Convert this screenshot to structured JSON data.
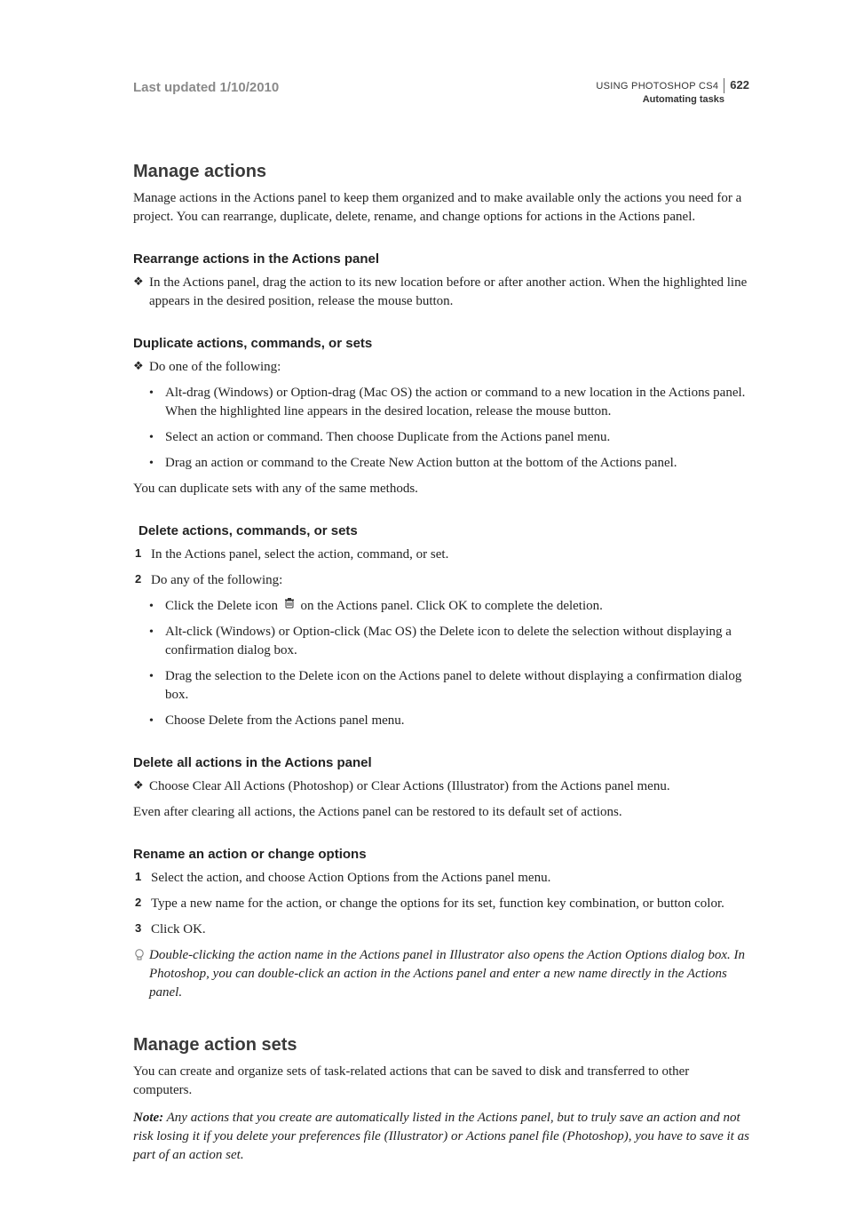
{
  "header": {
    "last_updated": "Last updated 1/10/2010",
    "using": "USING PHOTOSHOP CS4",
    "page_number": "622",
    "section": "Automating tasks"
  },
  "s1": {
    "title": "Manage actions",
    "intro": "Manage actions in the Actions panel to keep them organized and to make available only the actions you need for a project. You can rearrange, duplicate, delete, rename, and change options for actions in the Actions panel."
  },
  "rearrange": {
    "heading": "Rearrange actions in the Actions panel",
    "item": "In the Actions panel, drag the action to its new location before or after another action. When the highlighted line appears in the desired position, release the mouse button."
  },
  "duplicate": {
    "heading": "Duplicate actions, commands, or sets",
    "lead": "Do one of the following:",
    "b1": "Alt-drag (Windows) or Option-drag (Mac OS) the action or command to a new location in the Actions panel. When the highlighted line appears in the desired location, release the mouse button.",
    "b2": "Select an action or command. Then choose Duplicate from the Actions panel menu.",
    "b3": "Drag an action or command to the Create New Action button at the bottom of the Actions panel.",
    "tail": "You can duplicate sets with any of the same methods."
  },
  "delete": {
    "heading": "Delete actions, commands, or sets",
    "n1": "In the Actions panel, select the action, command, or set.",
    "n2": "Do any of the following:",
    "b1a": "Click the Delete icon ",
    "b1b": " on the Actions panel. Click OK to complete the deletion.",
    "b2": "Alt-click (Windows) or Option-click (Mac OS) the Delete icon to delete the selection without displaying a confirmation dialog box.",
    "b3": "Drag the selection to the Delete icon on the Actions panel to delete without displaying a confirmation dialog box.",
    "b4": "Choose Delete from the Actions panel menu."
  },
  "deleteall": {
    "heading": "Delete all actions in the Actions panel",
    "item": "Choose Clear All Actions (Photoshop) or Clear Actions (Illustrator) from the Actions panel menu.",
    "tail": "Even after clearing all actions, the Actions panel can be restored to its default set of actions."
  },
  "rename": {
    "heading": "Rename an action or change options",
    "n1": "Select the action, and choose Action Options from the Actions panel menu.",
    "n2": "Type a new name for the action, or change the options for its set, function key combination, or button color.",
    "n3": "Click OK.",
    "tip": "Double-clicking the action name in the Actions panel in Illustrator also opens the Action Options dialog box. In Photoshop, you can double-click an action in the Actions panel and enter a new name directly in the Actions panel."
  },
  "s2": {
    "title": "Manage action sets",
    "intro": "You can create and organize sets of task-related actions that can be saved to disk and transferred to other computers.",
    "note_label": "Note:",
    "note": " Any actions that you create are automatically listed in the Actions panel, but to truly save an action and not risk losing it if you delete your preferences file (Illustrator) or Actions panel file (Photoshop), you have to save it as part of an action set."
  }
}
